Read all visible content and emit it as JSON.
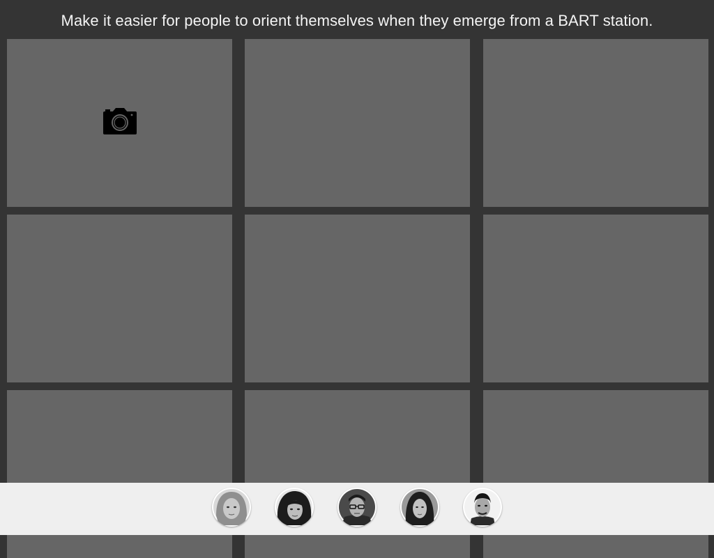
{
  "prompt": {
    "text": "Make it easier for people to orient themselves when they emerge from a BART station."
  },
  "grid": {
    "rows": 3,
    "columns": 3,
    "tiles": [
      {
        "icon": "camera-icon"
      },
      {},
      {},
      {},
      {},
      {},
      {},
      {},
      {}
    ]
  },
  "participants": [
    {
      "icon": "avatar-photo"
    },
    {
      "icon": "avatar-photo"
    },
    {
      "icon": "avatar-photo"
    },
    {
      "icon": "avatar-photo"
    },
    {
      "icon": "avatar-photo"
    }
  ],
  "colors": {
    "background": "#343434",
    "tile": "#666666",
    "tray": "#efefef",
    "text": "#f4f4f4"
  }
}
